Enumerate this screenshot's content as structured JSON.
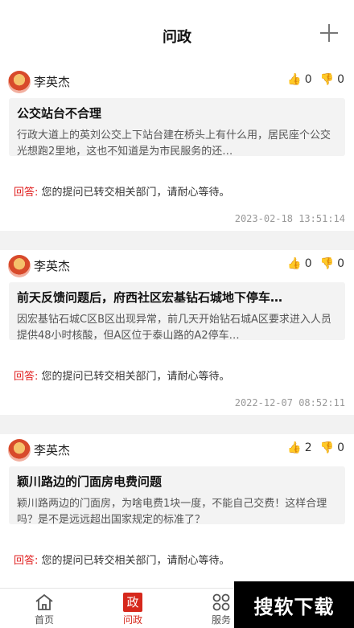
{
  "header": {
    "title": "问政",
    "add_icon": "plus-icon"
  },
  "posts": [
    {
      "author": "李英杰",
      "likes": "0",
      "dislikes": "0",
      "title": "公交站台不合理",
      "body": "行政大道上的英刘公交上下站台建在桥头上有什么用，居民座个公交光想跑2里地，这也不知道是为市民服务的还…",
      "reply_label": "回答:",
      "reply_text": "您的提问已转交相关部门，请耐心等待。",
      "time": "2023-02-18 13:51:14"
    },
    {
      "author": "李英杰",
      "likes": "0",
      "dislikes": "0",
      "title": "前天反馈问题后，府西社区宏基钻石城地下停车…",
      "body": "因宏基钻石城C区B区出现异常，前几天开始钻石城A区要求进入人员提供48小时核酸，但A区位于泰山路的A2停车…",
      "reply_label": "回答:",
      "reply_text": "您的提问已转交相关部门，请耐心等待。",
      "time": "2022-12-07 08:52:11"
    },
    {
      "author": "李英杰",
      "likes": "2",
      "dislikes": "0",
      "title": "颖川路边的门面房电费问题",
      "body": "颖川路两边的门面房，为啥电费1块一度，不能自己交费！这样合理吗？是不是远远超出国家规定的标准了？",
      "reply_label": "回答:",
      "reply_text": "您的提问已转交相关部门，请耐心等待。",
      "time": ""
    }
  ],
  "tabs": {
    "home": "首页",
    "wenzheng": "问政",
    "wenzheng_icon_char": "政",
    "service": "服务"
  },
  "watermark": "搜软下载",
  "colors": {
    "accent": "#d6281c",
    "reply_label": "#e02020"
  }
}
